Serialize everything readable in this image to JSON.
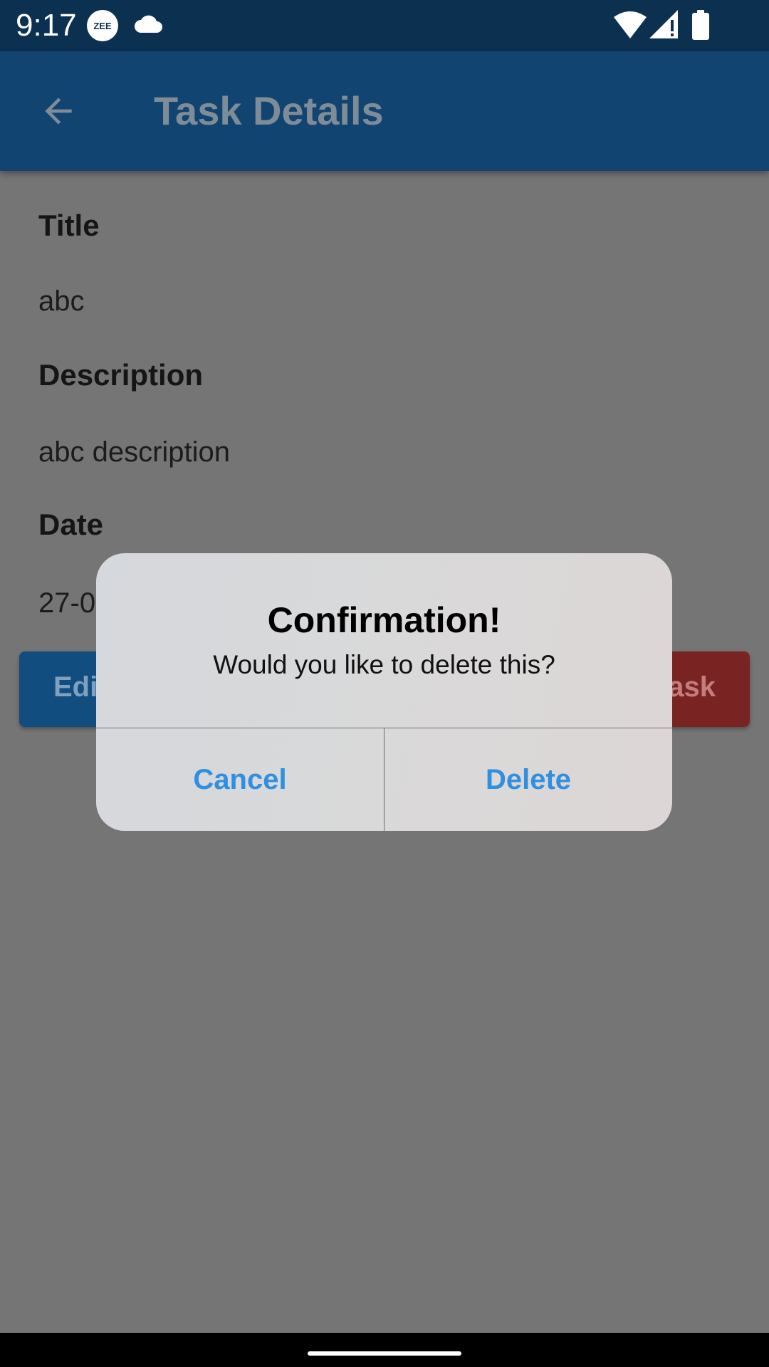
{
  "status_bar": {
    "time": "9:17",
    "badge": "ZEE",
    "icons": [
      "zee-app-icon",
      "cloud-icon",
      "wifi-icon",
      "signal-icon",
      "battery-icon"
    ]
  },
  "app_bar": {
    "back_icon": "arrow-back-icon",
    "title": "Task Details"
  },
  "details": {
    "title_label": "Title",
    "title_value": "abc",
    "description_label": "Description",
    "description_value": "abc description",
    "date_label": "Date",
    "date_value_visible": "27-0"
  },
  "buttons": {
    "edit_visible": "Edi",
    "delete_task_visible": "ask"
  },
  "dialog": {
    "title": "Confirmation!",
    "message": "Would you like to delete this?",
    "cancel_label": "Cancel",
    "confirm_label": "Delete"
  },
  "colors": {
    "status_bar": "#0b3050",
    "app_bar": "#114470",
    "scrim": "#757575",
    "edit_button": "#114d7e",
    "delete_button": "#7a2323",
    "dialog_action": "#2f8fe0"
  }
}
